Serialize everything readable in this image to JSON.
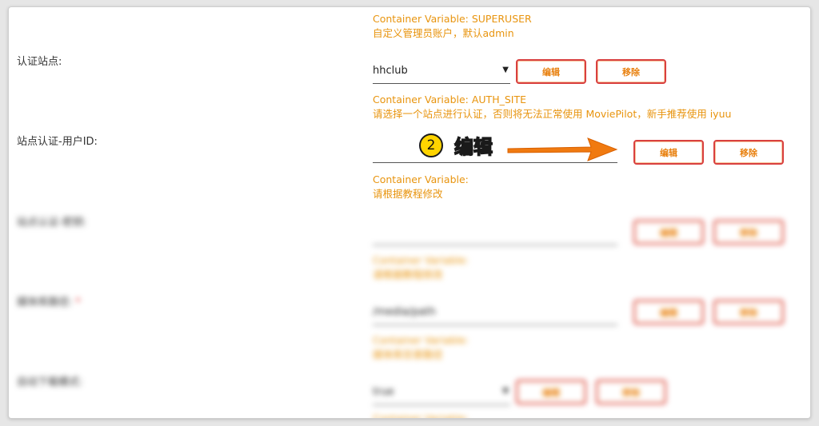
{
  "top_hint": {
    "line1": "Container Variable: SUPERUSER",
    "line2": "自定义管理员账户，默认admin"
  },
  "auth_site": {
    "label": "认证站点:",
    "value": "hhclub",
    "edit_label": "编辑",
    "remove_label": "移除",
    "hint_line1": "Container Variable: AUTH_SITE",
    "hint_line2": "请选择一个站点进行认证，否则将无法正常使用 MoviePilot，新手推荐使用 iyuu"
  },
  "user_id": {
    "label": "站点认证-用户ID:",
    "value": "",
    "edit_label": "编辑",
    "remove_label": "移除",
    "hint_line1": "Container Variable:",
    "hint_line2": "请根据教程修改"
  },
  "annotation": {
    "step_number": "2",
    "step_text": "编辑",
    "arrow_color": "#f07a10"
  },
  "blurred_rows": [
    {
      "label": "站点认证-密钥:",
      "value": "",
      "hint_line1": "Container Variable:",
      "hint_line2": "请根据教程修改",
      "edit_label": "编辑",
      "remove_label": "移除"
    },
    {
      "label": "媒体库路径:",
      "value": "/media/path",
      "hint_line1": "Container Variable:",
      "hint_line2": "媒体库目录路径",
      "edit_label": "编辑",
      "remove_label": "移除"
    },
    {
      "label": "自动下载模式:",
      "value": "true",
      "hint_line1": "Container Variable:",
      "hint_line2": "",
      "edit_label": "编辑",
      "remove_label": "移除"
    }
  ],
  "colors": {
    "hint": "#e8940e",
    "button_border": "#d94040",
    "button_text": "#e8800e"
  }
}
